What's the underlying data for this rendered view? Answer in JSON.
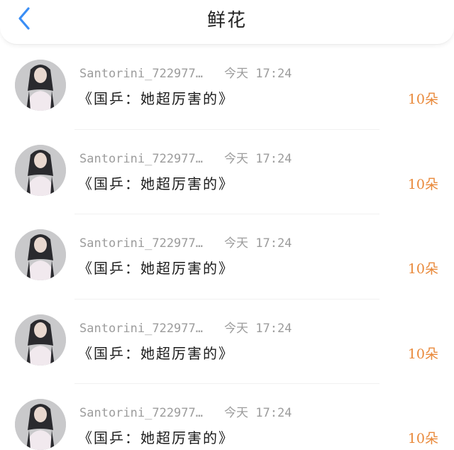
{
  "header": {
    "title": "鲜花",
    "back_icon": "chevron-left-icon",
    "accent_color": "#3a8ef5"
  },
  "rows": [
    {
      "username": "Santorini_722977…",
      "time": "今天 17:24",
      "message": "《国乒：她超厉害的》",
      "amount": "10朵"
    },
    {
      "username": "Santorini_722977…",
      "time": "今天 17:24",
      "message": "《国乒：她超厉害的》",
      "amount": "10朵"
    },
    {
      "username": "Santorini_722977…",
      "time": "今天 17:24",
      "message": "《国乒：她超厉害的》",
      "amount": "10朵"
    },
    {
      "username": "Santorini_722977…",
      "time": "今天 17:24",
      "message": "《国乒：她超厉害的》",
      "amount": "10朵"
    },
    {
      "username": "Santorini_722977…",
      "time": "今天 17:24",
      "message": "《国乒：她超厉害的》",
      "amount": "10朵"
    }
  ]
}
